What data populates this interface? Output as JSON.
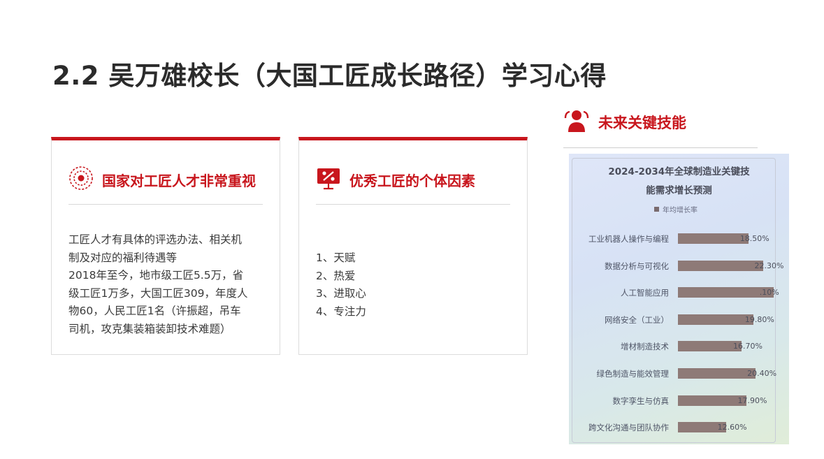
{
  "page": {
    "title": "2.2 吴万雄校长（大国工匠成长路径）学习心得"
  },
  "card1": {
    "icon": "target-icon",
    "heading": "国家对工匠人才非常重视",
    "lines": [
      "工匠人才有具体的评选办法、相关机",
      "制及对应的福利待遇等",
      "2018年至今，地市级工匠5.5万，省",
      "级工匠1万多，大国工匠309，年度人",
      "物60，人民工匠1名（许振超，吊车",
      "司机，攻克集装箱装卸技术难题）"
    ]
  },
  "card2": {
    "icon": "percent-board-icon",
    "heading": "优秀工匠的个体因素",
    "items": [
      "1、天赋",
      "2、热爱",
      "3、进取心",
      "4、专注力"
    ]
  },
  "side": {
    "icon": "people-icon",
    "heading": "未来关键技能"
  },
  "chart_data": {
    "type": "bar",
    "orientation": "horizontal",
    "title_line1": "2024-2034年全球制造业关键技",
    "title_line2": "能需求增长预测",
    "legend": "年均增长率",
    "categories": [
      "工业机器人操作与编程",
      "数据分析与可视化",
      "人工智能应用",
      "网络安全（工业）",
      "增材制造技术",
      "绿色制造与能效管理",
      "数字孪生与仿真",
      "跨文化沟通与团队协作"
    ],
    "values": [
      18.5,
      22.3,
      25.1,
      19.8,
      16.7,
      20.4,
      17.9,
      12.6
    ],
    "value_labels": [
      "18.50%",
      "22.30%",
      ".10%",
      "19.80%",
      "16.70%",
      "20.40%",
      "17.90%",
      "12.60%"
    ],
    "bar_color": "#8e7a77"
  }
}
